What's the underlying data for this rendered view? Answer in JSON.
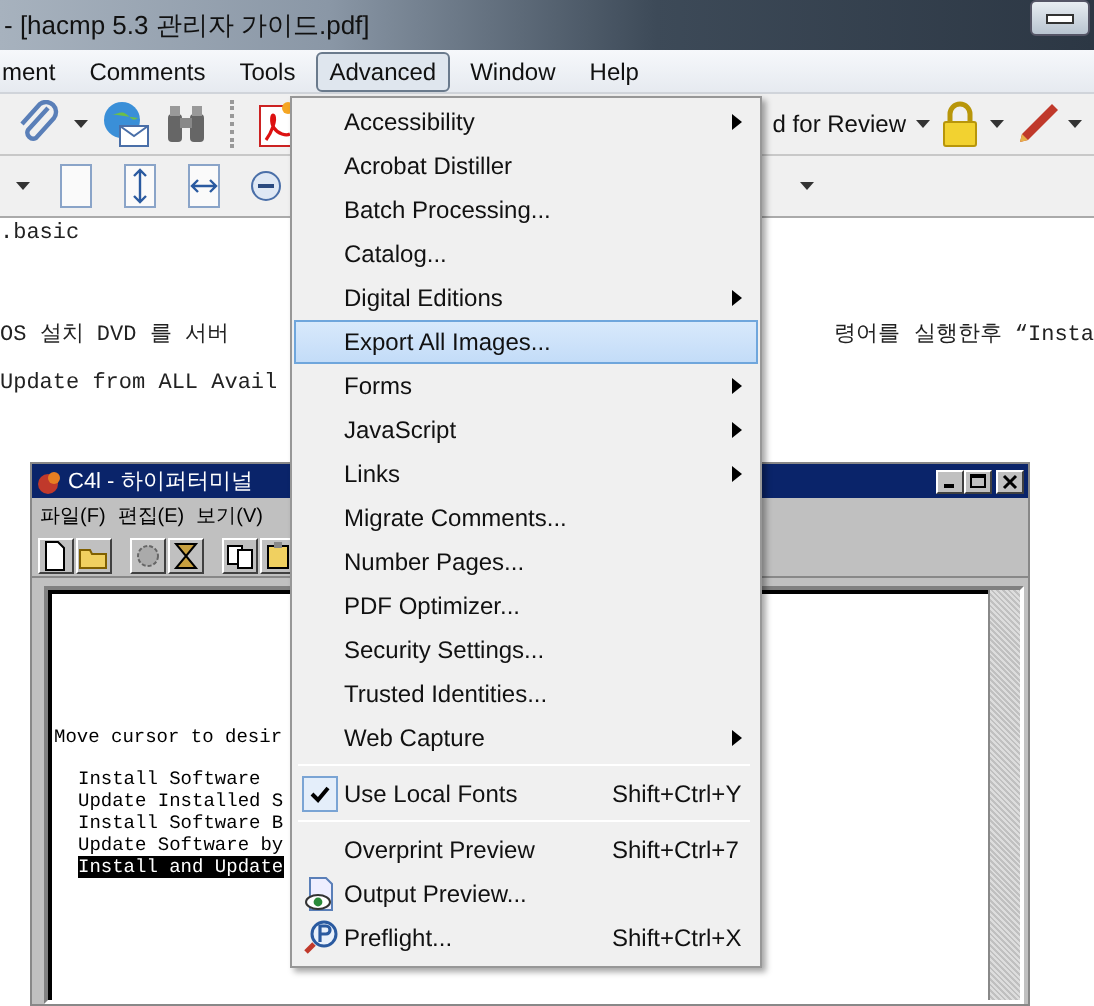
{
  "window": {
    "title": "- [hacmp 5.3 관리자 가이드.pdf]"
  },
  "menu_bar": [
    {
      "label": "ment",
      "selected": false
    },
    {
      "label": "Comments",
      "selected": false
    },
    {
      "label": "Tools",
      "selected": false
    },
    {
      "label": "Advanced",
      "selected": true
    },
    {
      "label": "Window",
      "selected": false
    },
    {
      "label": "Help",
      "selected": false
    }
  ],
  "toolbar": {
    "review_button": "d for Review"
  },
  "document": {
    "lines": [
      {
        "left": ".basic"
      },
      {
        "left": "OS 설치 DVD 를 서버",
        "right": "령어를 실행한후  “Insta"
      },
      {
        "left": "Update from ALL Avail"
      }
    ]
  },
  "terminal_window": {
    "title": "C4l - 하이퍼터미널",
    "menus": [
      "파일(F)",
      "편집(E)",
      "보기(V)"
    ],
    "lines": [
      {
        "kind": "prompt",
        "text": "Move cursor to desir",
        "selected": false
      },
      {
        "kind": "option",
        "text": "Install Software",
        "selected": false
      },
      {
        "kind": "option",
        "text": "Update Installed S",
        "selected": false
      },
      {
        "kind": "option",
        "text": "Install Software B",
        "selected": false
      },
      {
        "kind": "option",
        "text": "Update Software by",
        "selected": false
      },
      {
        "kind": "option",
        "text": "Install and Update",
        "selected": true
      }
    ]
  },
  "advanced_menu": {
    "items": [
      {
        "kind": "item",
        "label": "Accessibility",
        "submenu": true,
        "selected": false,
        "checked": false
      },
      {
        "kind": "item",
        "label": "Acrobat Distiller",
        "submenu": false,
        "selected": false,
        "checked": false
      },
      {
        "kind": "item",
        "label": "Batch Processing...",
        "submenu": false,
        "selected": false,
        "checked": false
      },
      {
        "kind": "item",
        "label": "Catalog...",
        "submenu": false,
        "selected": false,
        "checked": false
      },
      {
        "kind": "item",
        "label": "Digital Editions",
        "submenu": true,
        "selected": false,
        "checked": false
      },
      {
        "kind": "item",
        "label": "Export All Images...",
        "submenu": false,
        "selected": true,
        "checked": false
      },
      {
        "kind": "item",
        "label": "Forms",
        "submenu": true,
        "selected": false,
        "checked": false
      },
      {
        "kind": "item",
        "label": "JavaScript",
        "submenu": true,
        "selected": false,
        "checked": false
      },
      {
        "kind": "item",
        "label": "Links",
        "submenu": true,
        "selected": false,
        "checked": false
      },
      {
        "kind": "item",
        "label": "Migrate Comments...",
        "submenu": false,
        "selected": false,
        "checked": false
      },
      {
        "kind": "item",
        "label": "Number Pages...",
        "submenu": false,
        "selected": false,
        "checked": false
      },
      {
        "kind": "item",
        "label": "PDF Optimizer...",
        "submenu": false,
        "selected": false,
        "checked": false
      },
      {
        "kind": "item",
        "label": "Security Settings...",
        "submenu": false,
        "selected": false,
        "checked": false
      },
      {
        "kind": "item",
        "label": "Trusted Identities...",
        "submenu": false,
        "selected": false,
        "checked": false
      },
      {
        "kind": "item",
        "label": "Web Capture",
        "submenu": true,
        "selected": false,
        "checked": false
      },
      {
        "kind": "separator"
      },
      {
        "kind": "item",
        "label": "Use Local Fonts",
        "shortcut": "Shift+Ctrl+Y",
        "submenu": false,
        "selected": false,
        "checked": true
      },
      {
        "kind": "separator"
      },
      {
        "kind": "item",
        "label": "Overprint Preview",
        "shortcut": "Shift+Ctrl+7",
        "submenu": false,
        "selected": false,
        "checked": false
      },
      {
        "kind": "preview",
        "label": "Output Preview...",
        "submenu": false,
        "selected": false,
        "checked": false
      },
      {
        "kind": "preflight",
        "label": "Preflight...",
        "shortcut": "Shift+Ctrl+X",
        "submenu": false,
        "selected": false,
        "checked": false
      }
    ]
  }
}
